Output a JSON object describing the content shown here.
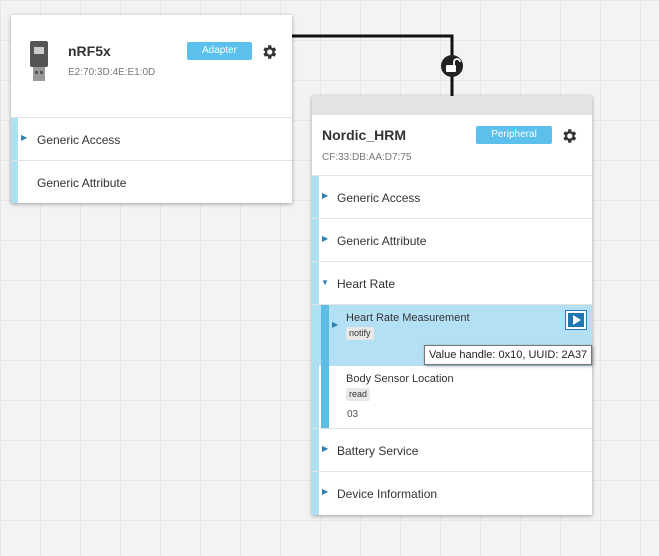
{
  "adapter": {
    "name": "nRF5x",
    "address": "E2:70:3D:4E:E1:0D",
    "role": "Adapter",
    "icons": {
      "device": "usb-dongle-icon",
      "settings": "gear-icon"
    },
    "services": [
      {
        "label": "Generic Access",
        "expandable": true
      },
      {
        "label": "Generic Attribute",
        "expandable": false
      }
    ]
  },
  "peripheral": {
    "name": "Nordic_HRM",
    "address": "CF:33:DB:AA:D7:75",
    "role": "Peripheral",
    "icons": {
      "settings": "gear-icon"
    },
    "services": [
      {
        "label": "Generic Access",
        "expanded": false
      },
      {
        "label": "Generic Attribute",
        "expanded": false
      },
      {
        "label": "Heart Rate",
        "expanded": true,
        "characteristics": [
          {
            "label": "Heart Rate Measurement",
            "property": "notify",
            "selected": true
          },
          {
            "label": "Body Sensor Location",
            "property": "read",
            "value": "03",
            "selected": false
          }
        ]
      },
      {
        "label": "Battery Service",
        "expanded": false
      },
      {
        "label": "Device Information",
        "expanded": false
      }
    ]
  },
  "tooltip": {
    "text": "Value handle: 0x10, UUID: 2A37"
  },
  "connection": {
    "icon": "unlock-icon"
  },
  "colors": {
    "accent": "#5bc0eb",
    "bar": "#aee0f4",
    "selected": "#b3e0f5",
    "play": "#1f78b4"
  }
}
